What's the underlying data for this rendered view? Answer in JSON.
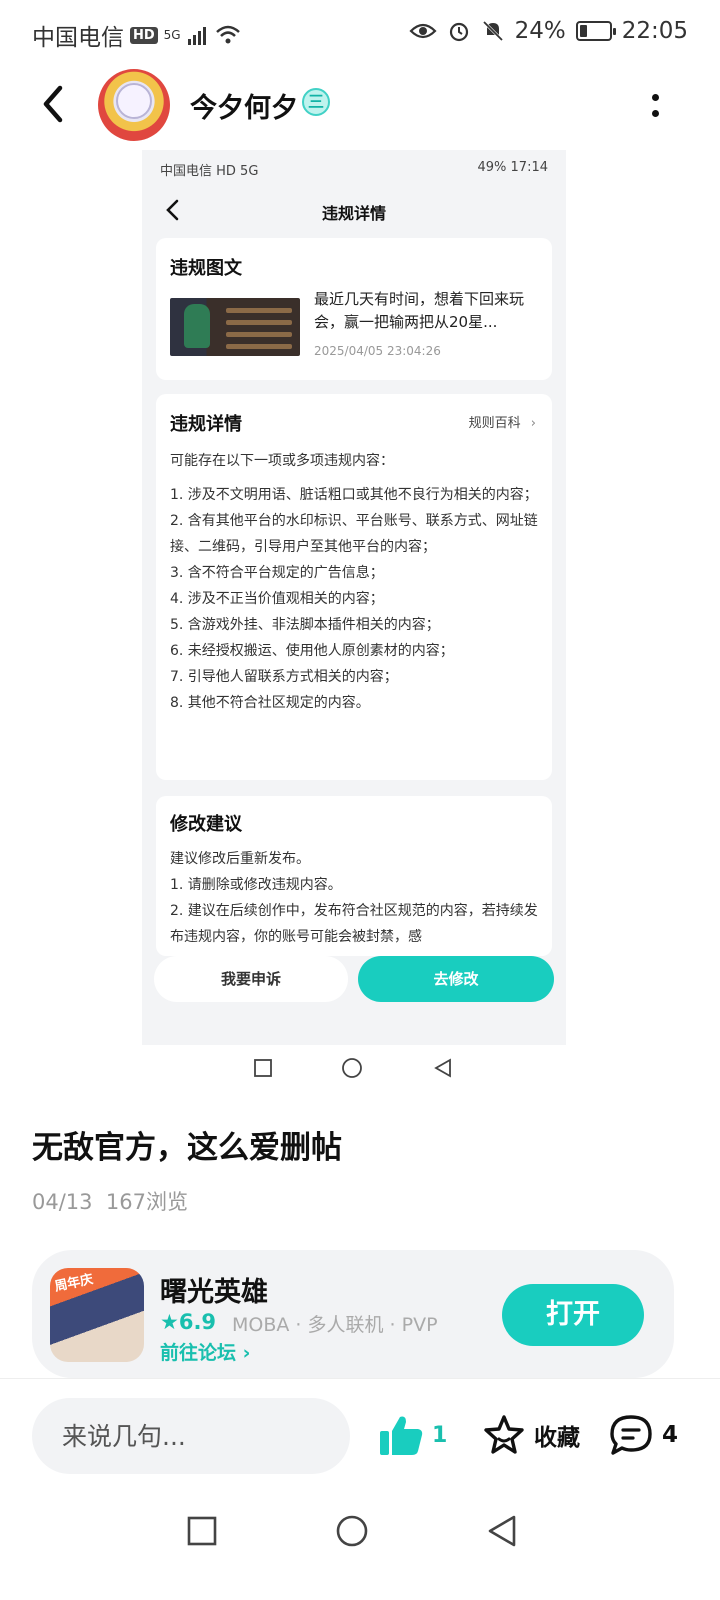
{
  "status_bar": {
    "carrier": "中国电信",
    "hd": "HD",
    "signal": "5G",
    "battery": "24%",
    "battery_level": 0.24,
    "time": "22:05"
  },
  "header": {
    "username": "今夕何夕",
    "verified_badge": "三"
  },
  "screenshot": {
    "status_left": "中国电信 HD 5G",
    "status_right": "49% 17:14",
    "title": "违规详情",
    "card1": {
      "heading": "违规图文",
      "post_excerpt": "最近几天有时间，想着下回来玩会，赢一把输两把从20星...",
      "post_time": "2025/04/05 23:04:26"
    },
    "card2": {
      "heading": "违规详情",
      "rules_link": "规则百科",
      "intro": "可能存在以下一项或多项违规内容：",
      "items": [
        "1. 涉及不文明用语、脏话粗口或其他不良行为相关的内容；",
        "2. 含有其他平台的水印标识、平台账号、联系方式、网址链接、二维码，引导用户至其他平台的内容；",
        "3. 含不符合平台规定的广告信息；",
        "4. 涉及不正当价值观相关的内容；",
        "5. 含游戏外挂、非法脚本插件相关的内容；",
        "6. 未经授权搬运、使用他人原创素材的内容；",
        "7. 引导他人留联系方式相关的内容；",
        "8. 其他不符合社区规定的内容。"
      ]
    },
    "card3": {
      "heading": "修改建议",
      "lines": [
        "建议修改后重新发布。",
        "1. 请删除或修改违规内容。",
        "2. 建议在后续创作中，发布符合社区规范的内容，若持续发布违规内容，你的账号可能会被封禁，感"
      ]
    },
    "appeal_button": "我要申诉",
    "fix_button": "去修改"
  },
  "post": {
    "title": "无敌官方，这么爱删帖",
    "date": "04/13",
    "views": "167浏览"
  },
  "game": {
    "name": "曙光英雄",
    "icon_badge": "周年庆",
    "rating": "6.9",
    "tags": "MOBA · 多人联机 · PVP",
    "forum_link": "前往论坛",
    "open_button": "打开"
  },
  "actions": {
    "comment_placeholder": "来说几句...",
    "like_count": "1",
    "favorite_label": "收藏",
    "comment_count": "4"
  },
  "colors": {
    "accent": "#19cdbf",
    "accent_text": "#19bfae"
  }
}
